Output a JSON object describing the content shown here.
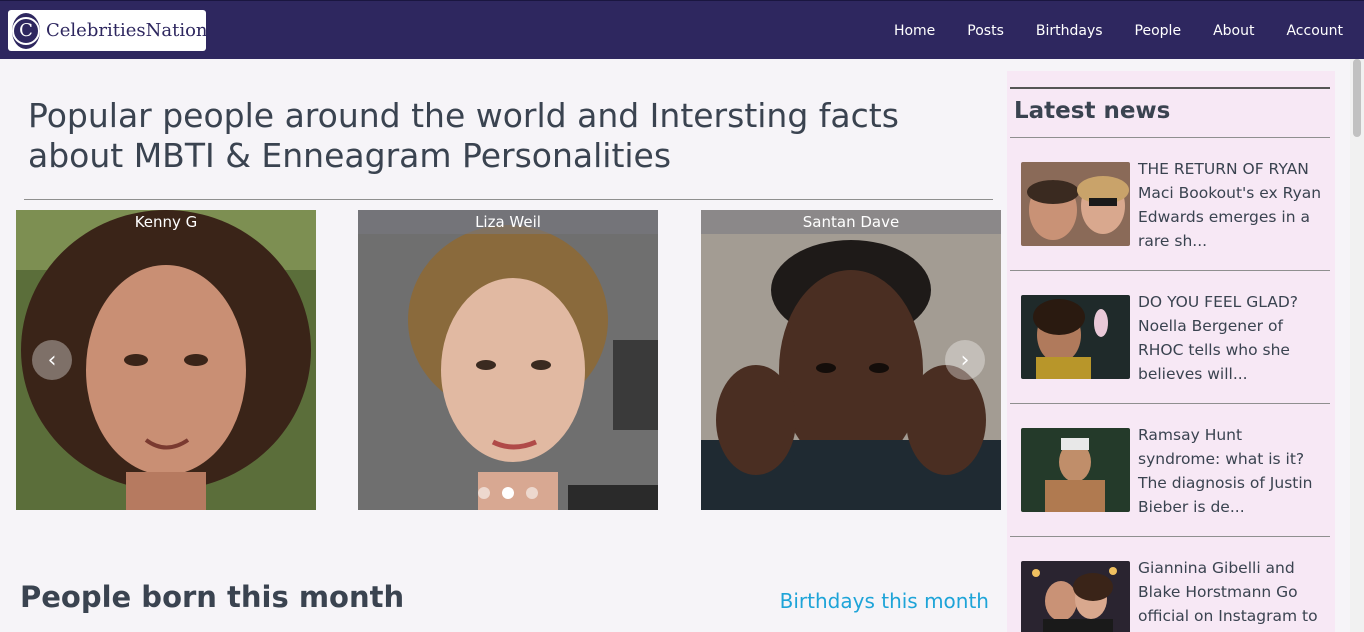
{
  "header": {
    "logo_letter": "C",
    "logo_text": "CelebritiesNation",
    "nav": [
      "Home",
      "Posts",
      "Birthdays",
      "People",
      "About",
      "Account"
    ]
  },
  "hero": {
    "title": "Popular people around the world and Intersting facts about MBTI & Enneagram Personalities"
  },
  "carousel": {
    "slides": [
      {
        "name": "Kenny G"
      },
      {
        "name": "Liza Weil"
      },
      {
        "name": "Santan Dave"
      }
    ],
    "prev_icon": "‹",
    "next_icon": "›",
    "active_index": 1
  },
  "born": {
    "title": "People born this month",
    "link": "Birthdays this month"
  },
  "sidebar": {
    "title": "Latest news",
    "items": [
      {
        "text": "THE RETURN OF RYAN Maci Bookout's ex Ryan Edwards emerges in a rare sh..."
      },
      {
        "text": "DO YOU FEEL GLAD? Noella Bergener of RHOC tells who she believes will..."
      },
      {
        "text": "Ramsay Hunt syndrome: what is it? The diagnosis of Justin Bieber is de..."
      },
      {
        "text": "Giannina Gibelli and Blake Horstmann Go official on Instagram to final..."
      }
    ]
  }
}
